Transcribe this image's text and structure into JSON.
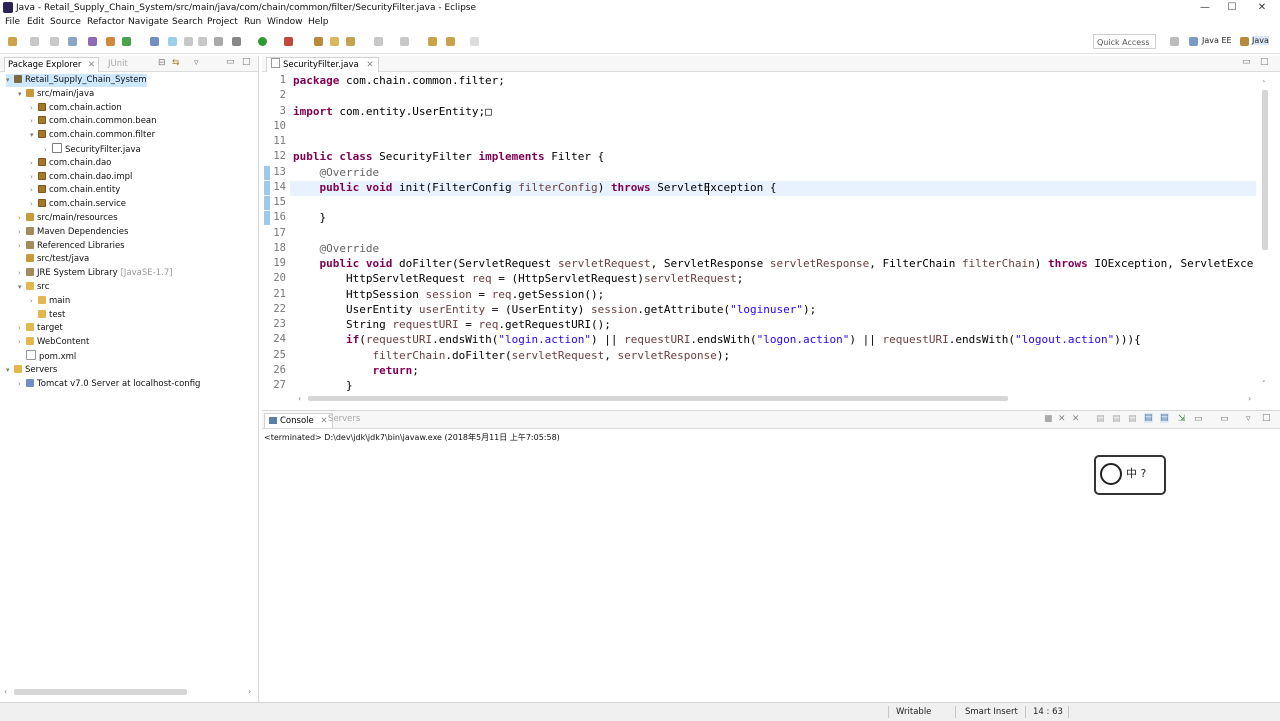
{
  "window": {
    "title": "Java - Retail_Supply_Chain_System/src/main/java/com/chain/common/filter/SecurityFilter.java - Eclipse",
    "buttons": {
      "minimize": "—",
      "maximize": "☐",
      "close": "✕"
    }
  },
  "menu": [
    "File",
    "Edit",
    "Source",
    "Refactor",
    "Navigate",
    "Search",
    "Project",
    "Run",
    "Window",
    "Help"
  ],
  "toolbar": {
    "quick_access": "Quick Access",
    "perspectives": [
      "Java EE",
      "Java"
    ]
  },
  "package_explorer": {
    "tab_active": "Package Explorer",
    "tab_inactive": "JUnit",
    "tree": [
      {
        "label": "Retail_Supply_Chain_System",
        "icon": "project-icon",
        "twisty": "▾",
        "selected": true
      },
      {
        "label": "src/main/java",
        "icon": "source-folder-icon",
        "twisty": "▾"
      },
      {
        "label": "com.chain.action",
        "icon": "package-icon",
        "twisty": "›"
      },
      {
        "label": "com.chain.common.bean",
        "icon": "package-icon",
        "twisty": "›"
      },
      {
        "label": "com.chain.common.filter",
        "icon": "package-icon",
        "twisty": "▾"
      },
      {
        "label": "SecurityFilter.java",
        "icon": "java-file-icon",
        "twisty": "›"
      },
      {
        "label": "com.chain.dao",
        "icon": "package-icon",
        "twisty": "›"
      },
      {
        "label": "com.chain.dao.impl",
        "icon": "package-icon",
        "twisty": "›"
      },
      {
        "label": "com.chain.entity",
        "icon": "package-icon",
        "twisty": "›"
      },
      {
        "label": "com.chain.service",
        "icon": "package-icon",
        "twisty": "›"
      },
      {
        "label": "src/main/resources",
        "icon": "source-folder-icon",
        "twisty": "›"
      },
      {
        "label": "Maven Dependencies",
        "icon": "library-icon",
        "twisty": "›"
      },
      {
        "label": "Referenced Libraries",
        "icon": "library-icon",
        "twisty": "›"
      },
      {
        "label": "src/test/java",
        "icon": "source-folder-icon",
        "twisty": ""
      },
      {
        "label": "JRE System Library",
        "suffix": "[JavaSE-1.7]",
        "icon": "library-icon",
        "twisty": "›"
      },
      {
        "label": "src",
        "icon": "folder-icon",
        "twisty": "▾"
      },
      {
        "label": "main",
        "icon": "folder-icon",
        "twisty": "›"
      },
      {
        "label": "test",
        "icon": "folder-icon",
        "twisty": ""
      },
      {
        "label": "target",
        "icon": "folder-icon",
        "twisty": "›"
      },
      {
        "label": "WebContent",
        "icon": "folder-icon",
        "twisty": "›"
      },
      {
        "label": "pom.xml",
        "icon": "xml-file-icon",
        "twisty": ""
      },
      {
        "label": "Servers",
        "icon": "folder-icon",
        "twisty": "▾"
      },
      {
        "label": "Tomcat v7.0 Server at localhost-config",
        "icon": "folder-icon",
        "twisty": "›"
      }
    ]
  },
  "editor": {
    "tab": "SecurityFilter.java",
    "line_numbers": [
      "1",
      "2",
      "3",
      "10",
      "11",
      "12",
      "13",
      "14",
      "15",
      "16",
      "17",
      "18",
      "19",
      "20",
      "21",
      "22",
      "23",
      "24",
      "25",
      "26",
      "27"
    ],
    "lines": [
      [
        [
          "kw",
          "package"
        ],
        [
          "t",
          " com.chain.common.filter;"
        ]
      ],
      [],
      [
        [
          "kw",
          "import"
        ],
        [
          "t",
          " com.entity.UserEntity;"
        ],
        [
          "t",
          "□"
        ]
      ],
      [],
      [],
      [
        [
          "kw",
          "public class"
        ],
        [
          "t",
          " SecurityFilter "
        ],
        [
          "kw",
          "implements"
        ],
        [
          "t",
          " Filter {"
        ]
      ],
      [
        [
          "t",
          "    "
        ],
        [
          "ann",
          "@Override"
        ]
      ],
      [
        [
          "t",
          "    "
        ],
        [
          "kw",
          "public void"
        ],
        [
          "t",
          " init(FilterConfig "
        ],
        [
          "par",
          "filterConfig"
        ],
        [
          "t",
          ") "
        ],
        [
          "kw",
          "throws"
        ],
        [
          "t",
          " ServletException {"
        ]
      ],
      [],
      [
        [
          "t",
          "    }"
        ]
      ],
      [],
      [
        [
          "t",
          "    "
        ],
        [
          "ann",
          "@Override"
        ]
      ],
      [
        [
          "t",
          "    "
        ],
        [
          "kw",
          "public void"
        ],
        [
          "t",
          " doFilter(ServletRequest "
        ],
        [
          "par",
          "servletRequest"
        ],
        [
          "t",
          ", ServletResponse "
        ],
        [
          "par",
          "servletResponse"
        ],
        [
          "t",
          ", FilterChain "
        ],
        [
          "par",
          "filterChain"
        ],
        [
          "t",
          ") "
        ],
        [
          "kw",
          "throws"
        ],
        [
          "t",
          " IOException, ServletExce"
        ]
      ],
      [
        [
          "t",
          "        HttpServletRequest "
        ],
        [
          "par",
          "req"
        ],
        [
          "t",
          " = (HttpServletRequest)"
        ],
        [
          "par",
          "servletRequest"
        ],
        [
          "t",
          ";"
        ]
      ],
      [
        [
          "t",
          "        HttpSession "
        ],
        [
          "par",
          "session"
        ],
        [
          "t",
          " = "
        ],
        [
          "par",
          "req"
        ],
        [
          "t",
          ".getSession();"
        ]
      ],
      [
        [
          "t",
          "        UserEntity "
        ],
        [
          "par",
          "userEntity"
        ],
        [
          "t",
          " = (UserEntity) "
        ],
        [
          "par",
          "session"
        ],
        [
          "t",
          ".getAttribute("
        ],
        [
          "str",
          "\"loginuser\""
        ],
        [
          "t",
          ");"
        ]
      ],
      [
        [
          "t",
          "        String "
        ],
        [
          "par",
          "requestURI"
        ],
        [
          "t",
          " = "
        ],
        [
          "par",
          "req"
        ],
        [
          "t",
          ".getRequestURI();"
        ]
      ],
      [
        [
          "t",
          "        "
        ],
        [
          "kw",
          "if"
        ],
        [
          "t",
          "("
        ],
        [
          "par",
          "requestURI"
        ],
        [
          "t",
          ".endsWith("
        ],
        [
          "str",
          "\"login.action\""
        ],
        [
          "t",
          ") || "
        ],
        [
          "par",
          "requestURI"
        ],
        [
          "t",
          ".endsWith("
        ],
        [
          "str",
          "\"logon.action\""
        ],
        [
          "t",
          ") || "
        ],
        [
          "par",
          "requestURI"
        ],
        [
          "t",
          ".endsWith("
        ],
        [
          "str",
          "\"logout.action\""
        ],
        [
          "t",
          "))){"
        ]
      ],
      [
        [
          "t",
          "            "
        ],
        [
          "par",
          "filterChain"
        ],
        [
          "t",
          ".doFilter("
        ],
        [
          "par",
          "servletRequest"
        ],
        [
          "t",
          ", "
        ],
        [
          "par",
          "servletResponse"
        ],
        [
          "t",
          ");"
        ]
      ],
      [
        [
          "t",
          "            "
        ],
        [
          "kw",
          "return"
        ],
        [
          "t",
          ";"
        ]
      ],
      [
        [
          "t",
          "        }"
        ]
      ]
    ]
  },
  "console": {
    "tab": "Console",
    "tab2": "Servers",
    "terminated": "<terminated> D:\\dev\\jdk\\jdk7\\bin\\javaw.exe (2018年5月11日 上午7:05:58)"
  },
  "status": {
    "writable": "Writable",
    "insert_mode": "Smart Insert",
    "position": "14 : 63"
  },
  "overlay": {
    "sticker_text": "中 ?"
  }
}
